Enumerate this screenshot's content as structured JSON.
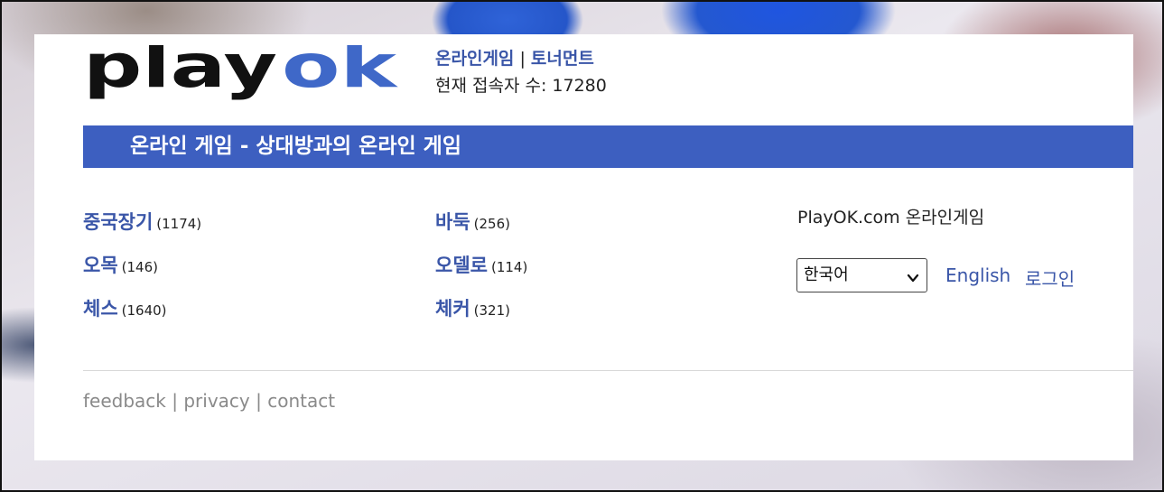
{
  "header": {
    "logo": {
      "text_dark": "play",
      "text_blue": "ok"
    },
    "nav": {
      "online_games": "온라인게임",
      "separator": "|",
      "tournaments": "토너먼트"
    },
    "online_users_label": "현재 접속자 수:",
    "online_users_value": "17280"
  },
  "banner": {
    "title": "온라인 게임 - 상대방과의 온라인 게임"
  },
  "games": [
    {
      "name": "중국장기",
      "count": "(1174)"
    },
    {
      "name": "바둑",
      "count": "(256)"
    },
    {
      "name": "오목",
      "count": "(146)"
    },
    {
      "name": "오델로",
      "count": "(114)"
    },
    {
      "name": "체스",
      "count": "(1640)"
    },
    {
      "name": "체커",
      "count": "(321)"
    }
  ],
  "sidebar": {
    "title": "PlayOK.com 온라인게임",
    "language_select": {
      "selected": "한국어",
      "icon": "chevron-down-icon"
    },
    "english_link": "English",
    "login_link": "로그인"
  },
  "footer": {
    "feedback": "feedback",
    "sep": "|",
    "privacy": "privacy",
    "contact": "contact"
  },
  "colors": {
    "brand_blue": "#3d5fc0",
    "link_blue": "#3a56a8",
    "logo_dark": "#111111",
    "logo_blue": "#3f68c8"
  }
}
